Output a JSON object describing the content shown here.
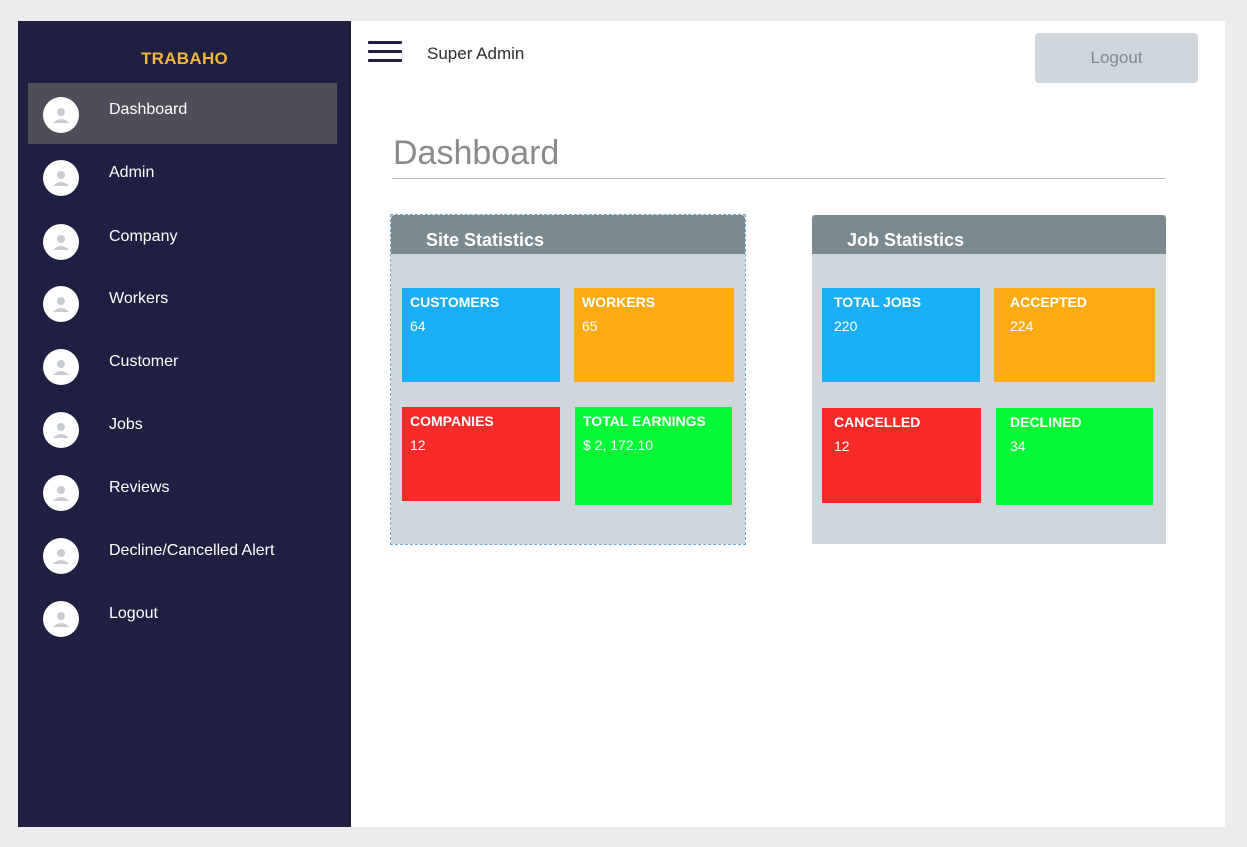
{
  "sidebar": {
    "brand": "TRABAHO",
    "items": [
      {
        "label": "Dashboard",
        "icon": "user-avatar-icon",
        "active": true
      },
      {
        "label": "Admin",
        "icon": "user-avatar-icon"
      },
      {
        "label": "Company",
        "icon": "user-avatar-icon"
      },
      {
        "label": "Workers",
        "icon": "user-avatar-icon"
      },
      {
        "label": "Customer",
        "icon": "user-avatar-icon"
      },
      {
        "label": "Jobs",
        "icon": "user-avatar-icon"
      },
      {
        "label": "Reviews",
        "icon": "user-avatar-icon"
      },
      {
        "label": "Decline/Cancelled Alert",
        "icon": "user-avatar-icon"
      },
      {
        "label": "Logout",
        "icon": "user-avatar-icon"
      }
    ]
  },
  "topbar": {
    "menu_icon": "hamburger-menu-icon",
    "user_role": "Super Admin",
    "logout_label": "Logout"
  },
  "page": {
    "title": "Dashboard"
  },
  "site_statistics": {
    "title": "Site Statistics",
    "customers": {
      "label": "CUSTOMERS",
      "value": "64",
      "color": "#1aaef5"
    },
    "workers": {
      "label": "WORKERS",
      "value": "65",
      "color": "#fbab13"
    },
    "companies": {
      "label": "COMPANIES",
      "value": "12",
      "color": "#f72a2a"
    },
    "total_earnings": {
      "label": "TOTAL EARNINGS",
      "value": "$ 2, 172.10",
      "color": "#05f935"
    }
  },
  "job_statistics": {
    "title": "Job Statistics",
    "total_jobs": {
      "label": "TOTAL JOBS",
      "value": "220",
      "color": "#1aaef5"
    },
    "accepted": {
      "label": "ACCEPTED",
      "value": "224",
      "color": "#fbab13"
    },
    "cancelled": {
      "label": "CANCELLED",
      "value": "12",
      "color": "#f72a2a"
    },
    "declined": {
      "label": "DECLINED",
      "value": "34",
      "color": "#05f935"
    }
  },
  "colors": {
    "sidebar_bg": "#1f1f42",
    "brand": "#f2b63c",
    "active_item_bg": "#4e4e58",
    "panel_bg": "#cfd6dc",
    "panel_header": "#7a8a8e"
  }
}
